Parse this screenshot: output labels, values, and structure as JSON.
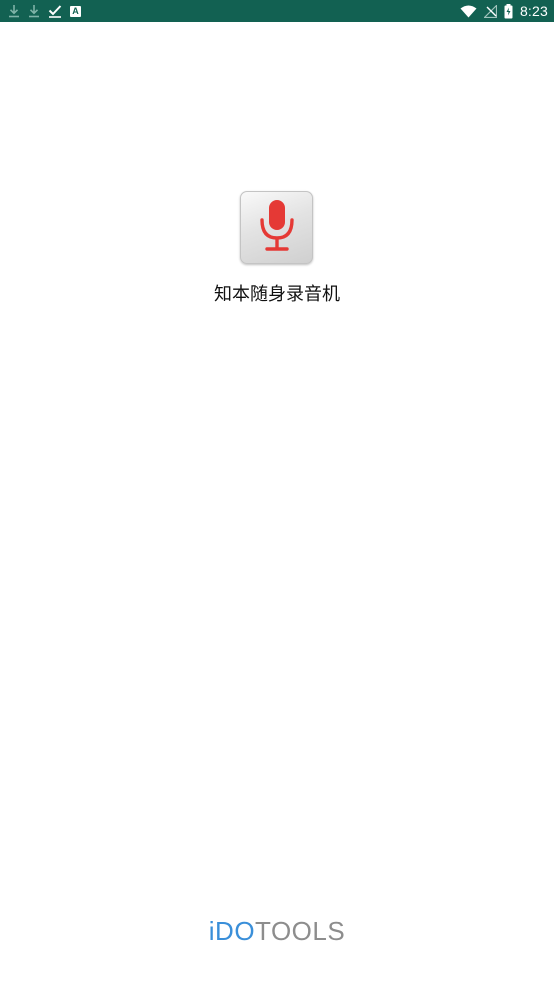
{
  "status_bar": {
    "time": "8:23",
    "left_icons": [
      "download-icon",
      "download-icon",
      "done-check-icon",
      "a-badge-icon"
    ],
    "a_badge_text": "A",
    "right_icons": [
      "wifi-icon",
      "no-signal-icon",
      "battery-icon"
    ],
    "background_color": "#126152"
  },
  "app": {
    "name": "知本随身录音机",
    "icon": "microphone-icon",
    "icon_accent_color": "#e53935"
  },
  "brand": {
    "part1": "iDO",
    "part2": "TOOLS",
    "part1_color": "#3a8fd9",
    "part2_color": "#8d8d8d"
  }
}
